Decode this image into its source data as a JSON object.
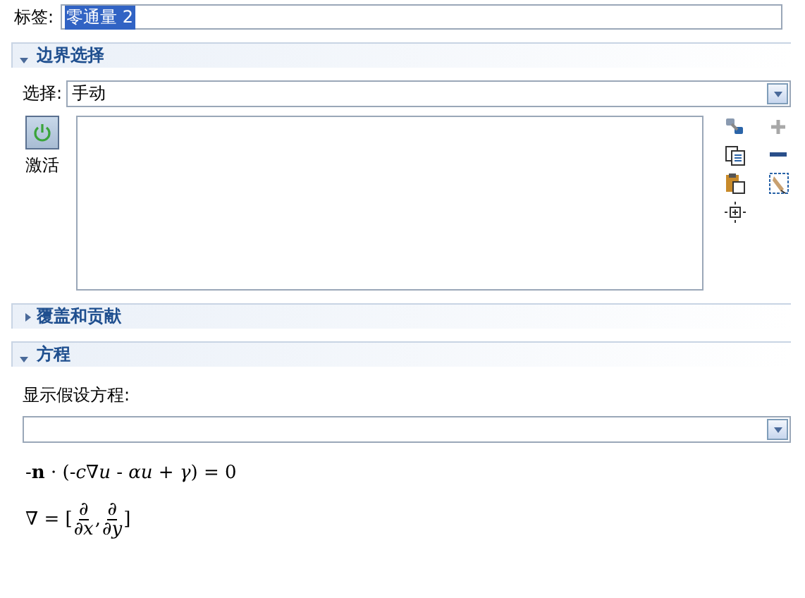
{
  "label_field": {
    "label": "标签:",
    "value": "零通量 2",
    "value_selected": true
  },
  "sections": [
    {
      "kind": "selection",
      "title": "边界选择",
      "expanded": true,
      "select_label": "选择:",
      "select_value": "手动",
      "activate_label": "激活",
      "activate_on": true,
      "tools": [
        {
          "kind": "link",
          "disabled": false
        },
        {
          "kind": "add",
          "disabled": true
        },
        {
          "kind": "copy",
          "disabled": false
        },
        {
          "kind": "remove",
          "disabled": false
        },
        {
          "kind": "paste",
          "disabled": false
        },
        {
          "kind": "clear",
          "disabled": false
        },
        {
          "kind": "zoom",
          "disabled": false
        }
      ]
    },
    {
      "title": "覆盖和贡献",
      "expanded": false
    },
    {
      "kind": "equation",
      "title": "方程",
      "expanded": true,
      "show_label": "显示假设方程:",
      "equation_1": "-**n** · (-*c*∇*u* - *αu* + *γ*) = 0",
      "equation_2": {
        "lhs": "∇ = [",
        "fractions": [
          {
            "num": "∂",
            "den": "∂x"
          },
          {
            "num": "∂",
            "den": "∂y"
          }
        ],
        "separator": ",",
        "close": "]"
      }
    }
  ]
}
